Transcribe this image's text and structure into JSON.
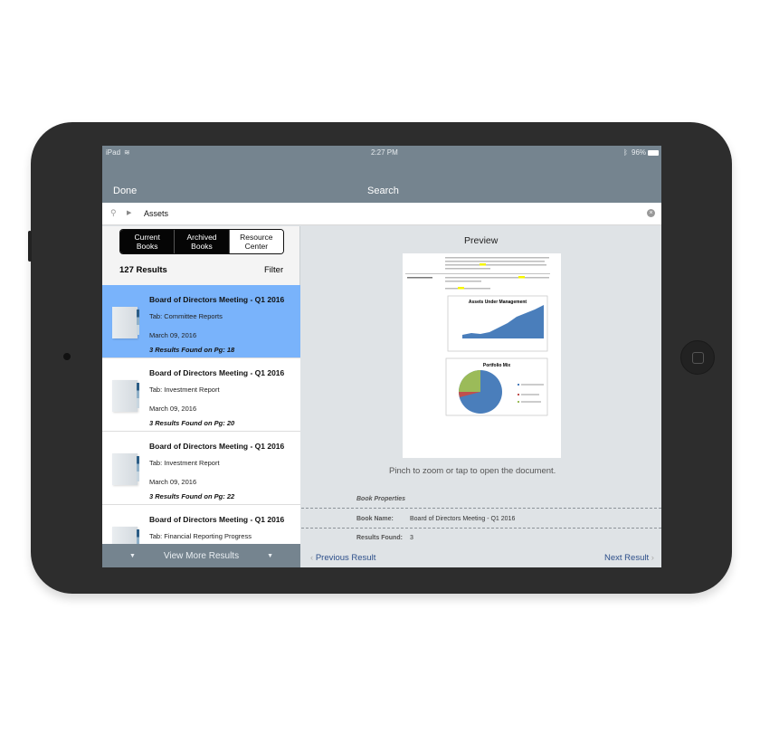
{
  "status": {
    "device": "iPad",
    "time": "2:27 PM",
    "battery": "96%"
  },
  "nav": {
    "done": "Done",
    "title": "Search"
  },
  "search": {
    "value": "Assets"
  },
  "segments": [
    {
      "label": "Current Books",
      "line1": "Current",
      "line2": "Books",
      "selected": true
    },
    {
      "label": "Archived Books",
      "line1": "Archived",
      "line2": "Books",
      "selected": true
    },
    {
      "label": "Resource Center",
      "line1": "Resource",
      "line2": "Center",
      "selected": false
    }
  ],
  "results": {
    "count": "127 Results",
    "filter": "Filter"
  },
  "items": [
    {
      "title": "Board of Directors Meeting - Q1 2016",
      "tab": "Tab: Committee Reports",
      "date": "March 09, 2016",
      "found": "3 Results Found on Pg: 18"
    },
    {
      "title": "Board of Directors Meeting - Q1 2016",
      "tab": "Tab: Investment Report",
      "date": "March 09, 2016",
      "found": "3 Results Found on Pg: 20"
    },
    {
      "title": "Board of Directors Meeting - Q1 2016",
      "tab": "Tab: Investment Report",
      "date": "March 09, 2016",
      "found": "3 Results Found on Pg: 22"
    },
    {
      "title": "Board of Directors Meeting - Q1 2016",
      "tab": "Tab: Financial Reporting Progress",
      "date": "",
      "found": ""
    }
  ],
  "view_more": "View More Results",
  "preview": {
    "title": "Preview",
    "hint": "Pinch to zoom or tap to open the document.",
    "doc_section": "AUM Expansion",
    "chart1_title": "Assets Under Management",
    "chart2_title": "Portfolio Mix"
  },
  "properties": {
    "heading": "Book Properties",
    "name_label": "Book Name:",
    "name_value": "Board of Directors Meeting - Q1 2016",
    "found_label": "Results Found:",
    "found_value": "3"
  },
  "footer": {
    "prev": "Previous Result",
    "next": "Next Result"
  },
  "colors": {
    "nav": "#75848f",
    "selected": "#79b3fb",
    "highlight": "#f5f500"
  }
}
